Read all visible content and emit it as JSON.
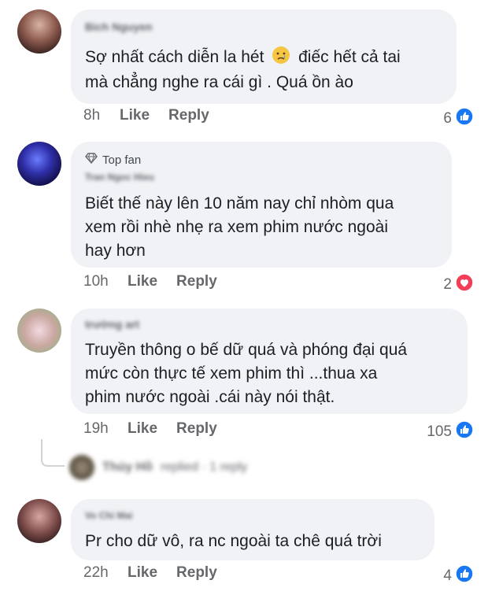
{
  "comments": [
    {
      "author": "Bich Nguyen",
      "text_lines": [
        "Sợ nhất cách diễn la hét",
        "điếc hết cả tai",
        "mà chẳng nghe ra cái gì . Quá ồn ào"
      ],
      "time": "8h",
      "like_label": "Like",
      "reply_label": "Reply",
      "reaction_count": "6",
      "reaction_icon": "like-icon",
      "emoji_icon": "crying-face-icon"
    },
    {
      "badge_label": "Top fan",
      "badge_icon": "diamond-icon",
      "author": "Tran Ngoc Hieu",
      "text_lines": [
        "Biết thế này lên 10 năm nay chỉ nhòm qua",
        "xem rồi nhè nhẹ ra xem phim nước ngoài",
        "hay hơn"
      ],
      "time": "10h",
      "like_label": "Like",
      "reply_label": "Reply",
      "reaction_count": "2",
      "reaction_icon": "love-icon"
    },
    {
      "author": "trường art",
      "text_lines": [
        "Truyền thông o bế dữ quá và phóng đại quá",
        "mức còn thực tế xem phim thì ...thua xa",
        "phim nước ngoài .cái này nói thật."
      ],
      "time": "19h",
      "like_label": "Like",
      "reply_label": "Reply",
      "reaction_count": "105",
      "reaction_icon": "like-icon",
      "replies_summary": {
        "author": "Thúy Hồ",
        "text": "replied · 1 reply"
      }
    },
    {
      "author": "Vo Chi Mai",
      "text_lines": [
        "Pr cho dữ vô, ra nc ngoài ta chê quá trời"
      ],
      "time": "22h",
      "like_label": "Like",
      "reply_label": "Reply",
      "reaction_count": "4",
      "reaction_icon": "like-icon"
    }
  ],
  "colors": {
    "bubble": "#f0f2f5",
    "meta_text": "#65676b",
    "like_blue": "#1877f2",
    "love_red": "#f33e58"
  }
}
